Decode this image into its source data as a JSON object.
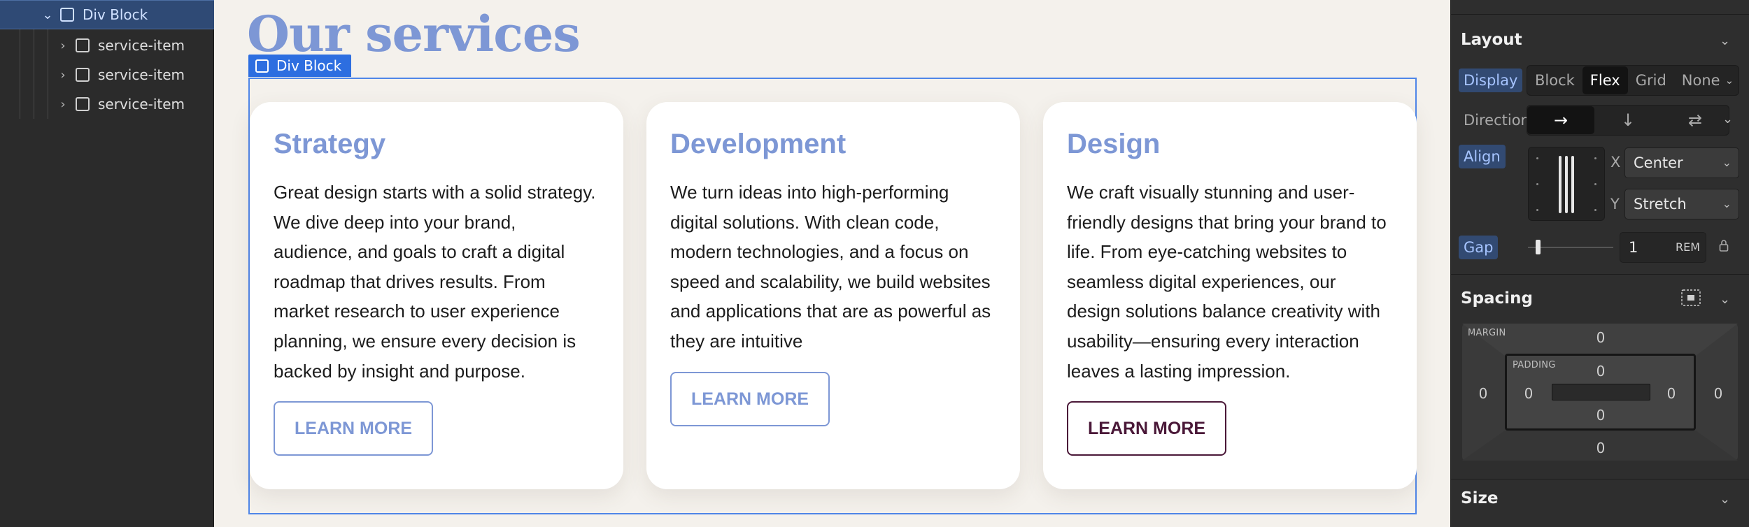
{
  "navigator": {
    "items": [
      {
        "label": "Div Block",
        "chevron": "⌄",
        "selected": true
      },
      {
        "label": "service-item",
        "chevron": "›",
        "selected": false
      },
      {
        "label": "service-item",
        "chevron": "›",
        "selected": false
      },
      {
        "label": "service-item",
        "chevron": "›",
        "selected": false
      }
    ]
  },
  "canvas": {
    "heading": "Our services",
    "selection_label": "Div Block",
    "cards": [
      {
        "title": "Strategy",
        "body": "Great design starts with a solid strategy. We dive deep into your brand, audience, and goals to craft a digital roadmap that drives results. From market research to user experience planning, we ensure every decision is backed by insight and purpose.",
        "button": "LEARN MORE"
      },
      {
        "title": "Development",
        "body": "We turn ideas into high-performing digital solutions. With clean code, modern technologies, and a focus on speed and scalability, we build websites and applications that are as powerful as they are intuitive",
        "button": "LEARN MORE"
      },
      {
        "title": "Design",
        "body": "We craft visually stunning and user-friendly designs that bring your brand to life. From eye-catching websites to seamless digital experiences, our design solutions balance creativity with usability—ensuring every interaction leaves a lasting impression.",
        "button": "LEARN MORE"
      }
    ]
  },
  "panel": {
    "layout": {
      "title": "Layout",
      "display_label": "Display",
      "display_options": [
        "Block",
        "Flex",
        "Grid",
        "None"
      ],
      "display_selected": "Flex",
      "direction_label": "Direction",
      "direction_icons": [
        "→",
        "↓",
        "⇄"
      ],
      "align_label": "Align",
      "x_label": "X",
      "x_value": "Center",
      "y_label": "Y",
      "y_value": "Stretch",
      "gap_label": "Gap",
      "gap_value": "1",
      "gap_unit": "REM"
    },
    "spacing": {
      "title": "Spacing",
      "margin_caption": "MARGIN",
      "padding_caption": "PADDING",
      "margin": {
        "top": "0",
        "right": "0",
        "bottom": "0",
        "left": "0"
      },
      "padding": {
        "top": "0",
        "right": "0",
        "bottom": "0",
        "left": "0"
      }
    },
    "size": {
      "title": "Size"
    }
  },
  "colors": {
    "accent_blue": "#7d97d5",
    "selection_blue": "#2d6ee0",
    "dark_button": "#4a1838",
    "canvas_bg": "#f4f1ec"
  }
}
